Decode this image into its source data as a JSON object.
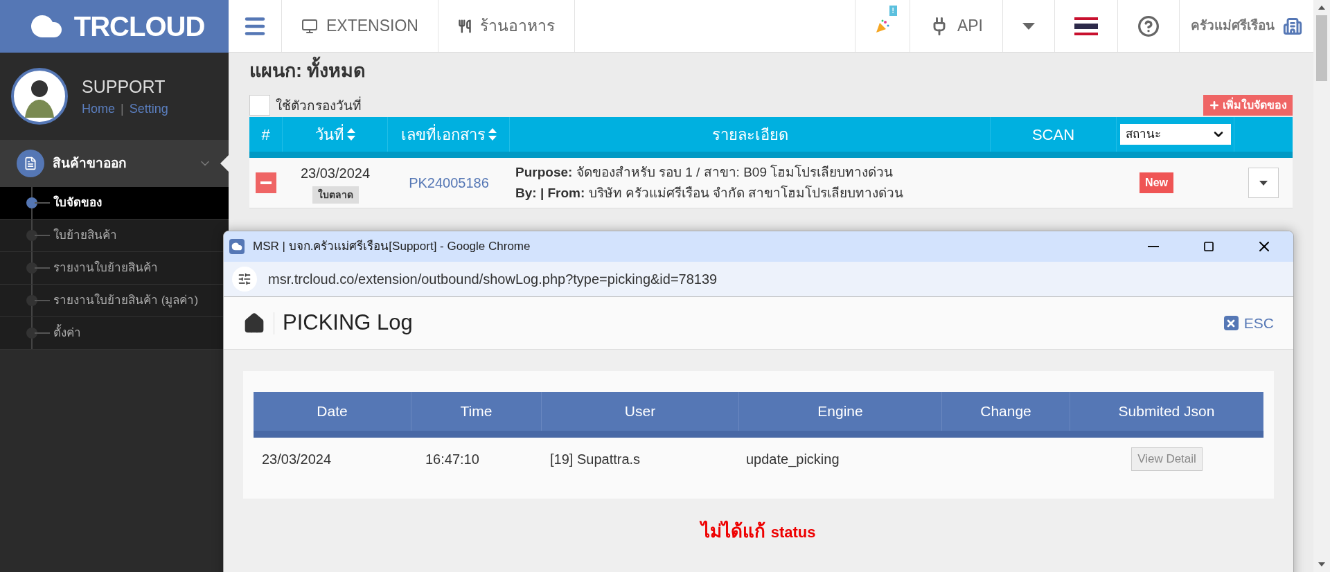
{
  "brand": {
    "logo": "TRCLOUD"
  },
  "topnav": {
    "items": [
      {
        "kind": "menu"
      },
      {
        "kind": "monitor",
        "label": "EXTENSION"
      },
      {
        "kind": "utensils",
        "label": "ร้านอาหาร"
      }
    ],
    "right": [
      {
        "kind": "party",
        "badge": "!"
      },
      {
        "kind": "plug",
        "label": "API"
      },
      {
        "kind": "caret"
      },
      {
        "kind": "flag"
      },
      {
        "kind": "help"
      },
      {
        "kind": "company",
        "label": "ครัวแม่ศรีเรือน"
      }
    ]
  },
  "profile": {
    "name": "SUPPORT",
    "links": [
      "Home",
      "Setting"
    ],
    "separator": "|"
  },
  "sidebar": {
    "group": {
      "label": "สินค้าขาออก",
      "expanded": true,
      "children": [
        {
          "label": "ใบจัดของ",
          "selected": true
        },
        {
          "label": "ใบย้ายสินค้า",
          "selected": false
        },
        {
          "label": "รายงานใบย้ายสินค้า",
          "selected": false
        },
        {
          "label": "รายงานใบย้ายสินค้า (มูลค่า)",
          "selected": false
        },
        {
          "label": "ตั้งค่า",
          "selected": false
        }
      ]
    }
  },
  "page": {
    "title": "แผนก: ทั้งหมด",
    "date_filter": {
      "label": "ใช้ตัวกรองวันที่",
      "checked": false
    },
    "add_button": "เพิ่มใบจัดของ",
    "table": {
      "columns": [
        {
          "label": "#",
          "sortable": false
        },
        {
          "label": "วันที่",
          "sortable": true
        },
        {
          "label": "เลขที่เอกสาร",
          "sortable": true
        },
        {
          "label": "รายละเอียด",
          "sortable": false
        },
        {
          "label": "SCAN",
          "sortable": false
        }
      ],
      "status_filter": "สถานะ",
      "rows": [
        {
          "date": "23/03/2024",
          "tag": "ใบตลาด",
          "doc_no": "PK24005186",
          "purpose_label": "Purpose:",
          "purpose": "จัดของสำหรับ รอบ 1 / สาขา: B09 โฮมโปรเลียบทางด่วน",
          "by_label": "By: | From:",
          "from": "บริษัท ครัวแม่ศรีเรือน จำกัด สาขาโฮมโปรเลียบทางด่วน",
          "status": "New"
        }
      ]
    }
  },
  "popup": {
    "title": "MSR | บจก.ครัวแม่ศรีเรือน[Support] - Google Chrome",
    "url": "msr.trcloud.co/extension/outbound/showLog.php?type=picking&id=78139",
    "heading": "PICKING Log",
    "esc": "ESC",
    "log_table": {
      "columns": [
        "Date",
        "Time",
        "User",
        "Engine",
        "Change",
        "Submited Json"
      ],
      "rows": [
        {
          "date": "23/03/2024",
          "time": "16:47:10",
          "user": "[19] Supattra.s",
          "engine": "update_picking",
          "action": "View Detail"
        }
      ]
    },
    "note_thai": "ไม่ได้แก้",
    "note_status": "status"
  }
}
